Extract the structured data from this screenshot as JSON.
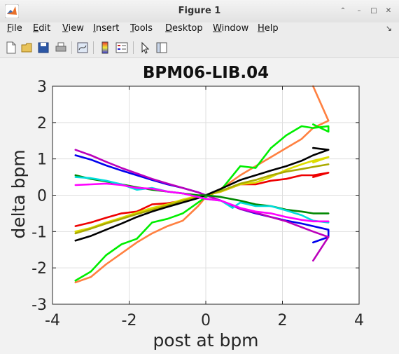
{
  "window": {
    "title": "Figure 1"
  },
  "menu": [
    "File",
    "Edit",
    "View",
    "Insert",
    "Tools",
    "Desktop",
    "Window",
    "Help"
  ],
  "toolbar": [
    "new-figure",
    "open-file",
    "save",
    "print",
    "link-plot",
    "colorbar",
    "legend",
    "edit-plot",
    "property-inspector"
  ],
  "chart_data": {
    "type": "line",
    "title": "BPM06-LIB.04",
    "xlabel": "post at bpm",
    "ylabel": "delta bpm",
    "xlim": [
      -4,
      4
    ],
    "ylim": [
      -3,
      3
    ],
    "xticks": [
      "-4",
      "-2",
      "0",
      "2",
      "4"
    ],
    "yticks": [
      "3",
      "2",
      "1",
      "0",
      "-1",
      "-2",
      "-3"
    ],
    "grid": true,
    "series": [
      {
        "color": "#ff8040",
        "x": [
          -3.4,
          -3.0,
          -2.6,
          -2.2,
          -1.8,
          -1.4,
          -1.0,
          -0.6,
          -0.2,
          0.0,
          0.2,
          0.5,
          0.9,
          1.3,
          1.7,
          2.1,
          2.5,
          2.8,
          3.2,
          2.8
        ],
        "y": [
          -2.4,
          -2.25,
          -1.9,
          -1.6,
          -1.3,
          -1.05,
          -0.85,
          -0.7,
          -0.3,
          -0.05,
          0.05,
          0.25,
          0.55,
          0.8,
          1.05,
          1.3,
          1.55,
          1.85,
          2.05,
          3.0
        ]
      },
      {
        "color": "#00ee00",
        "x": [
          -3.4,
          -3.0,
          -2.6,
          -2.2,
          -1.8,
          -1.4,
          -1.0,
          -0.6,
          -0.2,
          0.0,
          0.4,
          0.9,
          1.3,
          1.7,
          2.1,
          2.5,
          2.8,
          3.2,
          3.2,
          2.8
        ],
        "y": [
          -2.35,
          -2.1,
          -1.65,
          -1.35,
          -1.2,
          -0.75,
          -0.65,
          -0.5,
          -0.2,
          -0.05,
          0.15,
          0.8,
          0.75,
          1.3,
          1.65,
          1.9,
          1.85,
          1.9,
          1.75,
          1.95
        ]
      },
      {
        "color": "#ee0000",
        "x": [
          -3.4,
          -3.0,
          -2.6,
          -2.2,
          -1.8,
          -1.4,
          -1.0,
          -0.6,
          -0.2,
          0.0,
          0.4,
          0.9,
          1.3,
          1.7,
          2.1,
          2.5,
          2.8,
          3.2,
          2.8
        ],
        "y": [
          -0.85,
          -0.75,
          -0.62,
          -0.5,
          -0.45,
          -0.25,
          -0.22,
          -0.15,
          -0.05,
          0.0,
          0.1,
          0.3,
          0.3,
          0.4,
          0.45,
          0.55,
          0.55,
          0.62,
          0.5
        ]
      },
      {
        "color": "#dddd00",
        "x": [
          -3.4,
          -3.0,
          -2.6,
          -2.2,
          -1.8,
          -1.4,
          -1.0,
          -0.6,
          -0.2,
          0.0,
          0.4,
          0.9,
          1.3,
          1.7,
          2.1,
          2.5,
          2.8,
          3.2,
          2.8
        ],
        "y": [
          -1.0,
          -0.9,
          -0.75,
          -0.62,
          -0.48,
          -0.35,
          -0.25,
          -0.12,
          -0.02,
          0.0,
          0.1,
          0.3,
          0.35,
          0.5,
          0.7,
          0.85,
          0.95,
          1.05,
          0.9
        ]
      },
      {
        "color": "#aaaa00",
        "x": [
          -3.4,
          -3.0,
          -2.6,
          -2.2,
          -1.8,
          -1.4,
          -1.0,
          -0.6,
          -0.2,
          0.0,
          0.4,
          0.9,
          1.3,
          1.7,
          2.1,
          2.5,
          2.8,
          3.2
        ],
        "y": [
          -1.05,
          -0.92,
          -0.78,
          -0.65,
          -0.52,
          -0.4,
          -0.28,
          -0.15,
          -0.05,
          0.0,
          0.12,
          0.32,
          0.42,
          0.55,
          0.65,
          0.72,
          0.78,
          0.85
        ]
      },
      {
        "color": "#000000",
        "x": [
          -3.4,
          -3.0,
          -2.6,
          -2.2,
          -1.8,
          -1.4,
          -1.0,
          -0.6,
          -0.2,
          0.0,
          0.4,
          0.9,
          1.3,
          1.7,
          2.1,
          2.5,
          2.8,
          3.2,
          2.8
        ],
        "y": [
          -1.25,
          -1.12,
          -0.95,
          -0.78,
          -0.6,
          -0.45,
          -0.32,
          -0.2,
          -0.08,
          0.0,
          0.18,
          0.42,
          0.55,
          0.68,
          0.8,
          0.95,
          1.1,
          1.25,
          1.3
        ]
      },
      {
        "color": "#0000ee",
        "x": [
          -3.4,
          -3.0,
          -2.6,
          -2.2,
          -1.8,
          -1.4,
          -1.0,
          -0.6,
          -0.2,
          0.0,
          0.4,
          0.9,
          1.3,
          1.7,
          2.1,
          2.5,
          2.8,
          3.2,
          3.2,
          2.8
        ],
        "y": [
          1.1,
          0.98,
          0.82,
          0.68,
          0.55,
          0.42,
          0.3,
          0.2,
          0.08,
          0.0,
          -0.15,
          -0.38,
          -0.5,
          -0.6,
          -0.7,
          -0.78,
          -0.85,
          -0.95,
          -1.15,
          -1.3
        ]
      },
      {
        "color": "#bb00bb",
        "x": [
          -3.4,
          -3.0,
          -2.6,
          -2.2,
          -1.8,
          -1.4,
          -1.0,
          -0.6,
          -0.2,
          0.0,
          0.4,
          0.9,
          1.3,
          1.7,
          2.1,
          2.5,
          2.8,
          3.2,
          2.8
        ],
        "y": [
          1.25,
          1.1,
          0.92,
          0.75,
          0.6,
          0.45,
          0.32,
          0.2,
          0.08,
          0.0,
          -0.15,
          -0.38,
          -0.48,
          -0.6,
          -0.72,
          -0.88,
          -1.0,
          -1.15,
          -1.8
        ]
      },
      {
        "color": "#008800",
        "x": [
          -3.4,
          -3.0,
          -2.6,
          -2.2,
          -1.8,
          -1.4,
          -1.0,
          -0.6,
          -0.2,
          0.0,
          0.4,
          0.9,
          1.3,
          1.7,
          2.1,
          2.5,
          2.8,
          3.2
        ],
        "y": [
          0.55,
          0.45,
          0.38,
          0.3,
          0.22,
          0.15,
          0.1,
          0.05,
          0.0,
          0.0,
          -0.05,
          -0.15,
          -0.25,
          -0.3,
          -0.4,
          -0.45,
          -0.5,
          -0.5
        ]
      },
      {
        "color": "#00dddd",
        "x": [
          -3.4,
          -3.0,
          -2.6,
          -2.2,
          -1.8,
          -1.4,
          -1.0,
          -0.6,
          -0.2,
          0.0,
          0.4,
          0.7,
          0.9,
          1.3,
          1.7,
          2.1,
          2.5,
          2.8,
          3.2
        ],
        "y": [
          0.5,
          0.47,
          0.4,
          0.3,
          0.15,
          0.2,
          0.1,
          0.05,
          -0.05,
          -0.1,
          -0.15,
          -0.35,
          -0.2,
          -0.3,
          -0.3,
          -0.42,
          -0.55,
          -0.7,
          -0.75
        ]
      },
      {
        "color": "#ff00ff",
        "x": [
          -3.4,
          -3.0,
          -2.6,
          -2.2,
          -1.8,
          -1.4,
          -1.0,
          -0.6,
          -0.2,
          0.0,
          0.4,
          0.9,
          1.3,
          1.7,
          2.1,
          2.5,
          2.8,
          3.2
        ],
        "y": [
          0.28,
          0.3,
          0.32,
          0.28,
          0.2,
          0.18,
          0.1,
          0.05,
          -0.05,
          -0.1,
          -0.15,
          -0.35,
          -0.45,
          -0.5,
          -0.6,
          -0.68,
          -0.72,
          -0.72
        ]
      }
    ]
  }
}
